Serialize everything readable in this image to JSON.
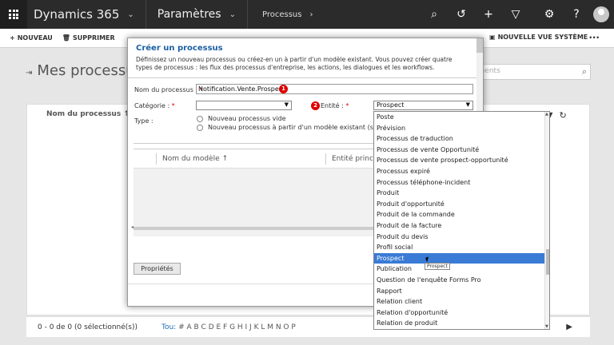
{
  "topbar": {
    "app_name": "Dynamics 365",
    "area": "Paramètres",
    "breadcrumb": "Processus",
    "icons": [
      "search-icon",
      "history-icon",
      "plus-icon",
      "filter-icon",
      "gear-icon",
      "help-icon",
      "user-avatar"
    ]
  },
  "commands": {
    "new": "NOUVEAU",
    "delete": "SUPPRIMER",
    "new_system_view": "NOUVELLE VUE SYSTÈME",
    "more": "···"
  },
  "page": {
    "title": "Mes processus",
    "search_placeholder": "ements",
    "grid_col": "Nom du processus ↑"
  },
  "status": {
    "count": "0 - 0 de 0 (0 sélectionné(s))",
    "all": "Tou:",
    "letters": "# A B C D E F G H I J K L M N O P"
  },
  "dialog": {
    "title": "Créer un processus",
    "description": "Définissez un nouveau processus ou créez-en un à partir d'un modèle existant. Vous pouvez créer quatre types de processus : les flux des processus d'entreprise, les actions, les dialogues et les workflows.",
    "name_label": "Nom du processus :",
    "name_value": "Notification.Vente.Prospect",
    "badge1": "1",
    "category_label": "Catégorie :",
    "category_value": "",
    "badge2": "2",
    "entity_label": "Entité :",
    "entity_value": "Prospect",
    "type_label": "Type :",
    "radio_empty": "Nouveau processus vide",
    "radio_template": "Nouveau processus à partir d'un modèle existant (sélection à",
    "col_template_name": "Nom du modèle ↑",
    "col_entity": "Entité princip",
    "properties_button": "Propriétés",
    "required_mark": "*"
  },
  "dropdown": {
    "items": [
      "Poste",
      "Prévision",
      "Processus de traduction",
      "Processus de vente Opportunité",
      "Processus de vente prospect-opportunité",
      "Processus expiré",
      "Processus téléphone-incident",
      "Produit",
      "Produit d'opportunité",
      "Produit de la commande",
      "Produit de la facture",
      "Produit du devis",
      "Profil social",
      "Prospect",
      "Publication",
      "Question de l'enquête Forms Pro",
      "Rapport",
      "Relation client",
      "Relation d'opportunité",
      "Relation de produit"
    ],
    "selected": "Prospect",
    "tooltip": "Prospect"
  }
}
